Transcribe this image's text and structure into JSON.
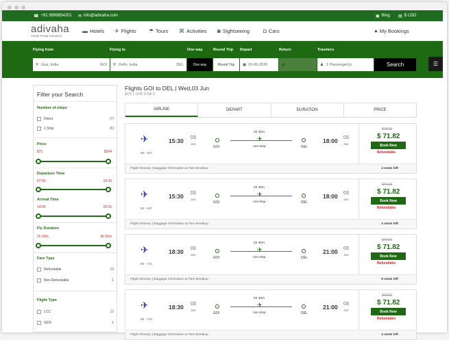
{
  "topbar": {
    "phone": "+91 9999854201",
    "email": "info@adivaha.com",
    "blog": "Blog",
    "currency": "$ USD"
  },
  "logo": {
    "name": "adivaha",
    "tagline": "Travel Portal Solutions"
  },
  "nav": {
    "hotels": "Hotels",
    "flights": "Flights",
    "tours": "Tours",
    "activities": "Activities",
    "sightseeing": "Sightseeing",
    "cars": "Cars",
    "bookings": "My Bookings"
  },
  "search": {
    "labels": {
      "from": "Flying from",
      "to": "Flying to",
      "oneway": "One way",
      "roundtrip": "Round Trip",
      "depart": "Depart",
      "return": "Return",
      "travelers": "Travelers"
    },
    "from_value": "Goa, India",
    "from_code": "GOI",
    "to_value": "Delhi, India",
    "to_code": "DEL",
    "oneway_btn": "One way",
    "roundtrip_btn": "Round Trip",
    "depart_value": "03-06-2020",
    "travelers_value": "1 Passenger(s)",
    "search_btn": "Search"
  },
  "filters": {
    "title": "Filter your Search",
    "stops": {
      "title": "Number of stops",
      "items": [
        {
          "label": "Direct",
          "count": "(7)"
        },
        {
          "label": "1 Stop",
          "count": "(6)"
        }
      ]
    },
    "price": {
      "title": "Price",
      "min": "$71",
      "max": "$144"
    },
    "departure": {
      "title": "Departure Time",
      "min": "07:50",
      "max": "18:30"
    },
    "arrival": {
      "title": "Arrival Time",
      "min": "14:05",
      "max": "22:35"
    },
    "duration": {
      "title": "Fly Duration",
      "min": "2h 30m",
      "max": "3h 55m"
    },
    "fare": {
      "title": "Fare Type",
      "items": [
        {
          "label": "Refundable",
          "count": "12"
        },
        {
          "label": "Non-Refundable",
          "count": "1"
        }
      ]
    },
    "flight_type": {
      "title": "Flight Type",
      "items": [
        {
          "label": "LCC",
          "count": "12"
        },
        {
          "label": "GDS",
          "count": "1"
        }
      ]
    }
  },
  "results": {
    "title": "Flights GOI to DEL  |  Wed,03 Jun",
    "passengers": "ADT 1 CHD 0 INF 0",
    "tabs": [
      "Airline",
      "Depart",
      "Duration",
      "Price"
    ],
    "flights": [
      {
        "code": "6E - 637",
        "dep_time": "15:30",
        "dep_day": "03",
        "dep_month": "Jun",
        "from": "GOI",
        "duration": "2h 30m",
        "stops": "non-stop",
        "to": "DEL",
        "arr_time": "18:00",
        "arr_day": "03",
        "arr_month": "Jun",
        "old_price": "$73.21",
        "price": "$ 71.82",
        "book": "Book Now",
        "refund": "Refundable",
        "links": "Flight Itinerary  |  Baggage Information & Fare Breakup",
        "seats": "4 seats left"
      },
      {
        "code": "6E - 637",
        "dep_time": "15:30",
        "dep_day": "03",
        "dep_month": "Jun",
        "from": "GOI",
        "duration": "2h 30m",
        "stops": "non-stop",
        "to": "DEL",
        "arr_time": "18:00",
        "arr_day": "03",
        "arr_month": "Jun",
        "old_price": "$73.21",
        "price": "$ 71.82",
        "book": "Book Now",
        "refund": "Refundable",
        "links": "Flight Itinerary  |  Baggage Information & Fare Breakup",
        "seats": "4 seats left"
      },
      {
        "code": "6E - 724",
        "dep_time": "18:30",
        "dep_day": "03",
        "dep_month": "Jun",
        "from": "GOI",
        "duration": "2h 30m",
        "stops": "non-stop",
        "to": "DEL",
        "arr_time": "21:00",
        "arr_day": "03",
        "arr_month": "Jun",
        "old_price": "$73.21",
        "price": "$ 71.82",
        "book": "Book Now",
        "refund": "Refundable",
        "links": "Flight Itinerary  |  Baggage Information & Fare Breakup",
        "seats": "9 seats left"
      },
      {
        "code": "6E - 724",
        "dep_time": "18:30",
        "dep_day": "03",
        "dep_month": "Jun",
        "from": "GOI",
        "duration": "2h 30m",
        "stops": "non-stop",
        "to": "DEL",
        "arr_time": "21:00",
        "arr_day": "03",
        "arr_month": "Jun",
        "old_price": "$73.21",
        "price": "$ 71.82",
        "book": "Book Now",
        "refund": "Refundable",
        "links": "Flight Itinerary  |  Baggage Information & Fare Breakup",
        "seats": "4 seats left"
      }
    ]
  }
}
